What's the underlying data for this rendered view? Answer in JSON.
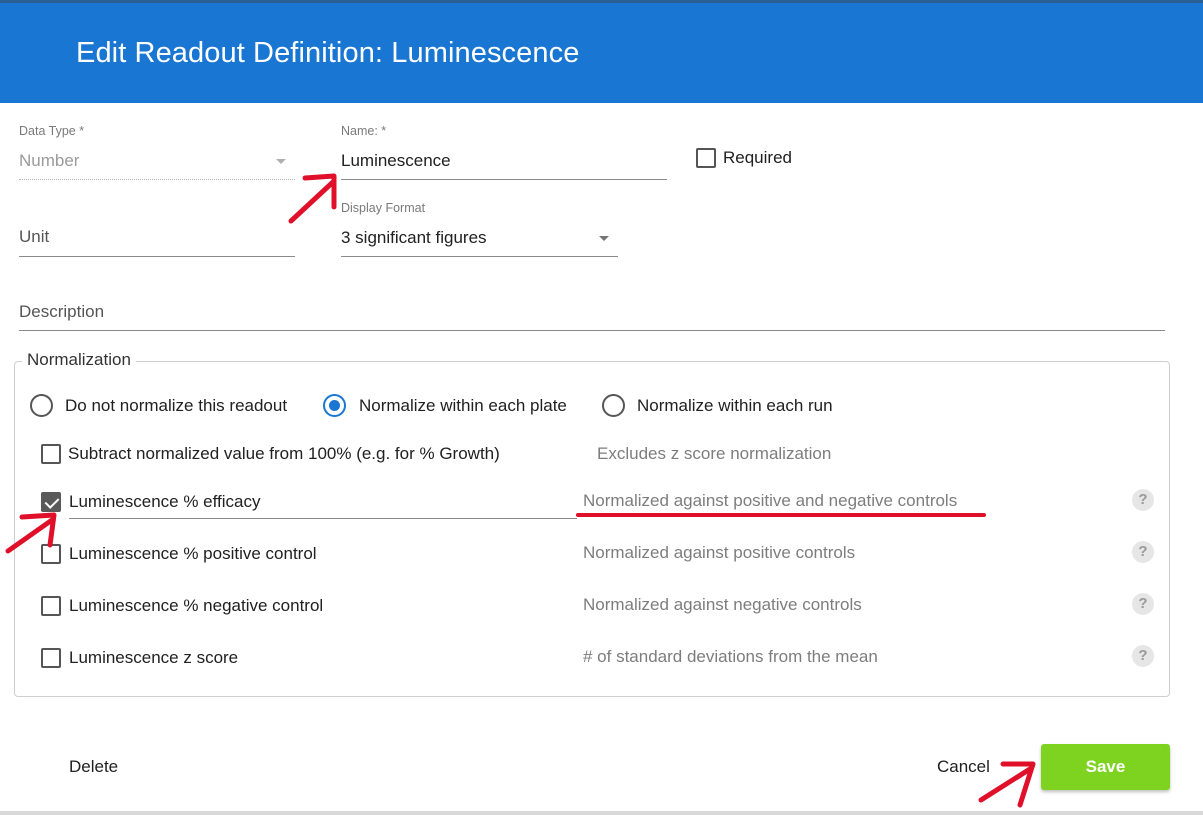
{
  "dialog": {
    "title": "Edit Readout Definition: Luminescence"
  },
  "form": {
    "data_type": {
      "label": "Data Type *",
      "value": "Number"
    },
    "name": {
      "label": "Name: *",
      "value": "Luminescence"
    },
    "required": {
      "label": "Required",
      "checked": false
    },
    "unit": {
      "placeholder": "Unit",
      "value": ""
    },
    "display_format": {
      "label": "Display Format",
      "value": "3 significant figures"
    },
    "description": {
      "placeholder": "Description",
      "value": ""
    }
  },
  "normalization": {
    "legend": "Normalization",
    "radios": [
      {
        "label": "Do not normalize this readout",
        "selected": false
      },
      {
        "label": "Normalize within each plate",
        "selected": true
      },
      {
        "label": "Normalize within each run",
        "selected": false
      }
    ],
    "subtract": {
      "label": "Subtract normalized value from 100% (e.g. for % Growth)",
      "note": "Excludes z score normalization",
      "checked": false
    },
    "options": [
      {
        "label": "Luminescence % efficacy",
        "description": "Normalized against positive and negative controls",
        "checked": true,
        "help_icon": "question-icon"
      },
      {
        "label": "Luminescence % positive control",
        "description": "Normalized against positive controls",
        "checked": false,
        "help_icon": "question-icon"
      },
      {
        "label": "Luminescence % negative control",
        "description": "Normalized against negative controls",
        "checked": false,
        "help_icon": "question-icon"
      },
      {
        "label": "Luminescence z score",
        "description": "# of standard deviations from the mean",
        "checked": false,
        "help_icon": "question-icon"
      }
    ],
    "help_glyph": "?"
  },
  "actions": {
    "delete_label": "Delete",
    "cancel_label": "Cancel",
    "save_label": "Save"
  },
  "colors": {
    "header": "#1976d2",
    "save": "#7ed321",
    "annotation": "#e0102b",
    "radio_selected": "#1976d2"
  }
}
